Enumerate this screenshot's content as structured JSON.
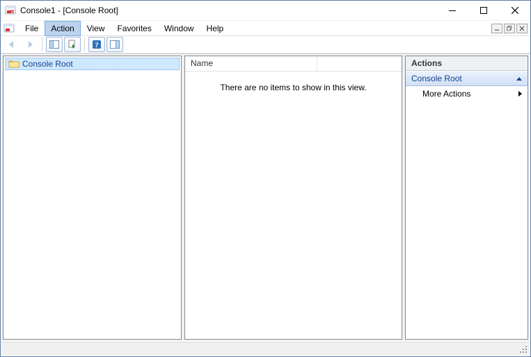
{
  "window": {
    "title": "Console1 - [Console Root]"
  },
  "menu": {
    "file": "File",
    "action": "Action",
    "view": "View",
    "favorites": "Favorites",
    "window": "Window",
    "help": "Help"
  },
  "tree": {
    "root_label": "Console Root"
  },
  "list": {
    "col_name": "Name",
    "empty_text": "There are no items to show in this view."
  },
  "actions": {
    "header": "Actions",
    "group_title": "Console Root",
    "more_actions": "More Actions"
  },
  "icons": {
    "app": "mmc-icon",
    "back": "back-arrow-icon",
    "forward": "forward-arrow-icon",
    "show_hide_tree": "show-hide-tree-icon",
    "export": "export-list-icon",
    "help": "help-icon",
    "show_hide_action": "show-hide-action-pane-icon",
    "folder": "folder-icon"
  }
}
